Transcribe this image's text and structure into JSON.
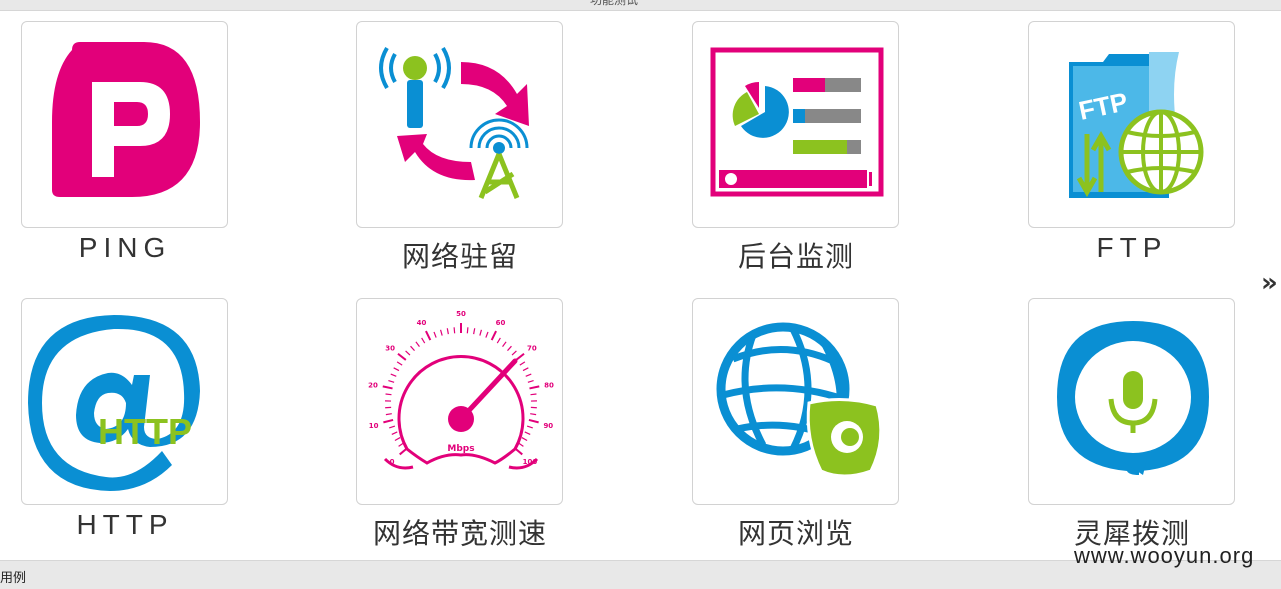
{
  "header": {
    "title_fragment": "功能测试"
  },
  "tiles": [
    {
      "label": "PING",
      "icon": "ping-p-icon"
    },
    {
      "label": "网络驻留",
      "icon": "network-dwell-icon"
    },
    {
      "label": "后台监测",
      "icon": "background-monitor-icon"
    },
    {
      "label": "FTP",
      "icon": "ftp-icon"
    },
    {
      "label": "HTTP",
      "icon": "http-at-icon"
    },
    {
      "label": "网络带宽测速",
      "icon": "speedometer-icon"
    },
    {
      "label": "网页浏览",
      "icon": "web-browse-icon"
    },
    {
      "label": "灵犀拨测",
      "icon": "voice-dial-icon"
    }
  ],
  "icon_text": {
    "ftp": "FTP",
    "http": "HTTP",
    "speed_unit": "Mbps",
    "speed_ticks": [
      "0",
      "10",
      "20",
      "30",
      "40",
      "50",
      "60",
      "70",
      "80",
      "90",
      "100"
    ]
  },
  "nav": {
    "next_symbol": "»"
  },
  "footer": {
    "fragment": "用例"
  },
  "watermark": "www.wooyun.org",
  "colors": {
    "magenta": "#e2007a",
    "blue": "#0a8fd3",
    "green": "#8cc21f",
    "gray": "#888888"
  }
}
